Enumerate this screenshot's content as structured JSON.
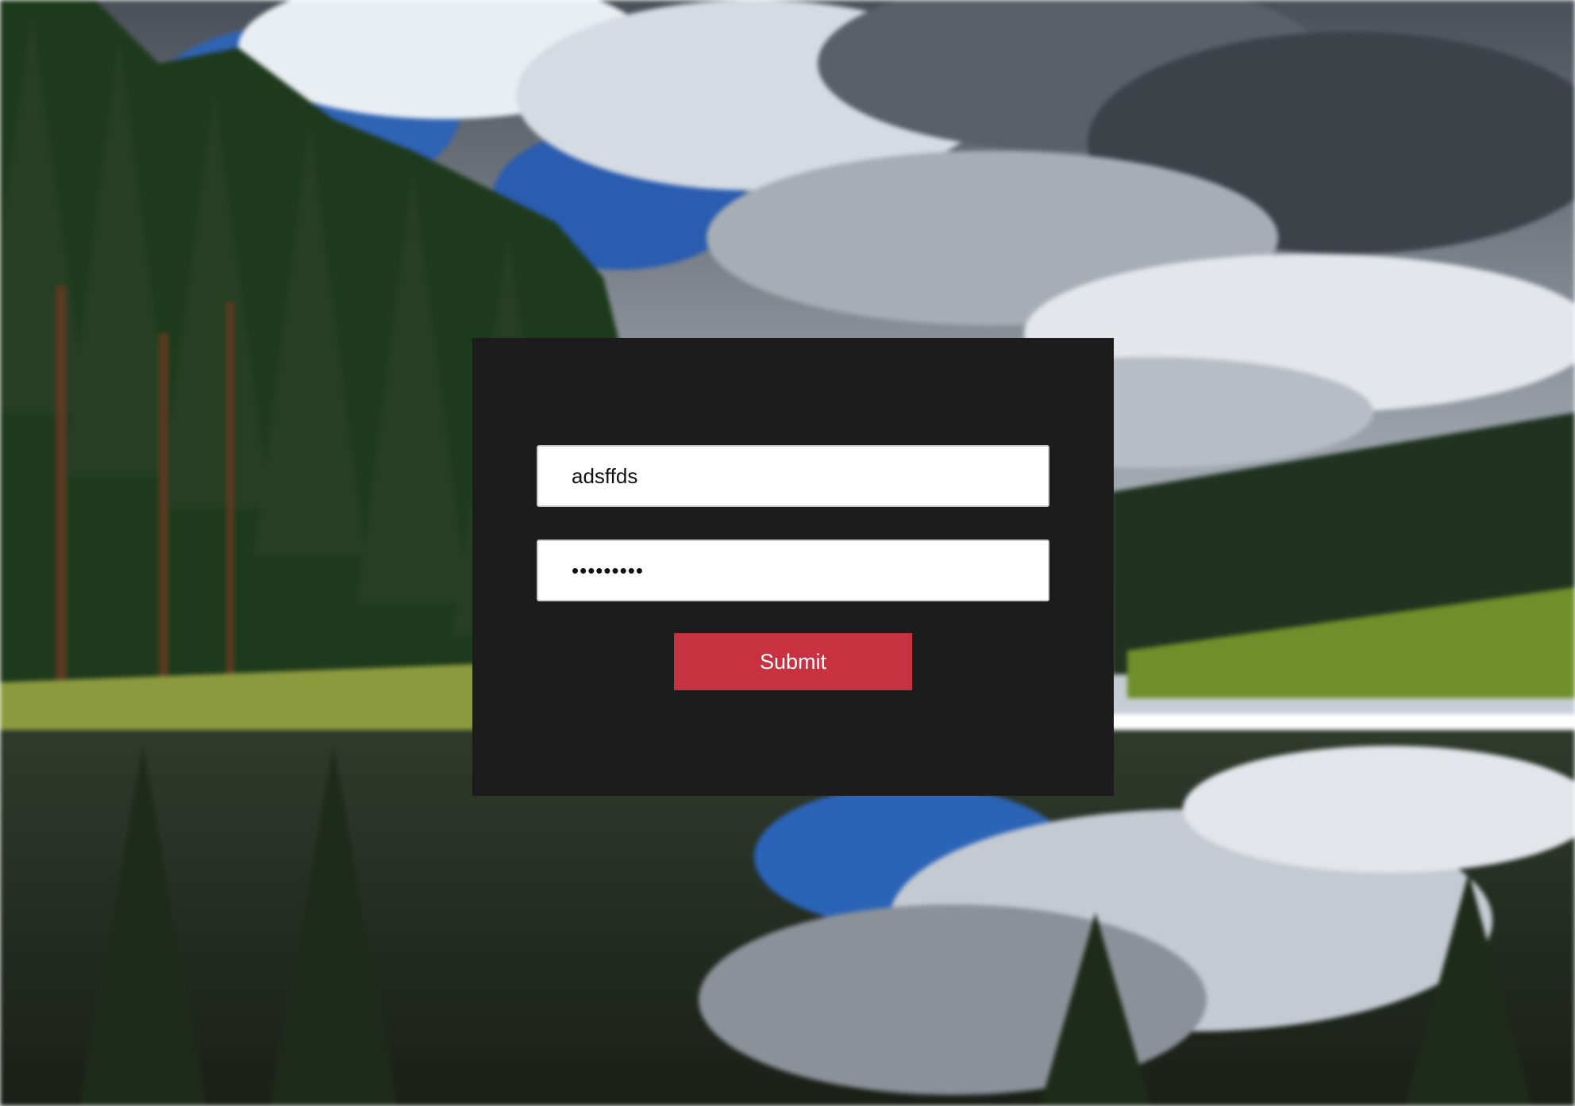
{
  "background": {
    "description_icon": "forest-lake-landscape"
  },
  "login_form": {
    "username_value": "adsffds",
    "password_value": "•••••••••",
    "submit_label": "Submit"
  },
  "colors": {
    "card_background": "#1c1c1c",
    "submit_button": "#c83140",
    "submit_text": "#ffffff",
    "input_background": "#ffffff"
  }
}
